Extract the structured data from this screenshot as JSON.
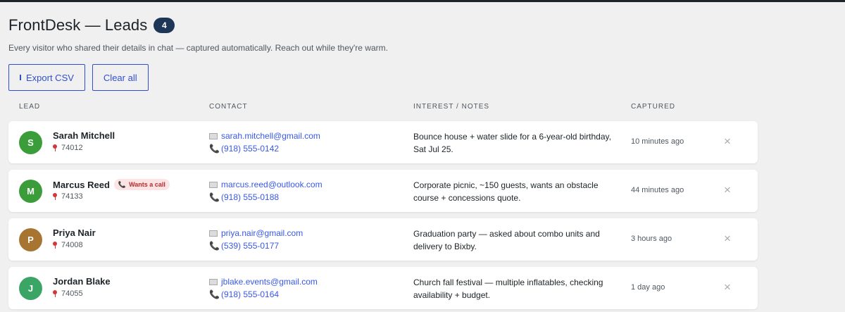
{
  "header": {
    "title": "FrontDesk — Leads",
    "count": "4",
    "subtitle": "Every visitor who shared their details in chat — captured automatically. Reach out while they're warm."
  },
  "actions": {
    "export_label": "Export CSV",
    "clear_label": "Clear all"
  },
  "columns": {
    "lead": "LEAD",
    "contact": "CONTACT",
    "interest": "INTEREST / NOTES",
    "captured": "CAPTURED"
  },
  "leads": [
    {
      "initial": "S",
      "avatar_color": "#3a9d3a",
      "name": "Sarah Mitchell",
      "zip": "74012",
      "badge": "",
      "email": "sarah.mitchell@gmail.com",
      "phone": "(918) 555-0142",
      "notes": "Bounce house + water slide for a 6-year-old birthday, Sat Jul 25.",
      "captured": "10 minutes ago"
    },
    {
      "initial": "M",
      "avatar_color": "#3a9d3a",
      "name": "Marcus Reed",
      "zip": "74133",
      "badge": "Wants a call",
      "email": "marcus.reed@outlook.com",
      "phone": "(918) 555-0188",
      "notes": "Corporate picnic, ~150 guests, wants an obstacle course + concessions quote.",
      "captured": "44 minutes ago"
    },
    {
      "initial": "P",
      "avatar_color": "#a87432",
      "name": "Priya Nair",
      "zip": "74008",
      "badge": "",
      "email": "priya.nair@gmail.com",
      "phone": "(539) 555-0177",
      "notes": "Graduation party — asked about combo units and delivery to Bixby.",
      "captured": "3 hours ago"
    },
    {
      "initial": "J",
      "avatar_color": "#3aa564",
      "name": "Jordan Blake",
      "zip": "74055",
      "badge": "",
      "email": "jblake.events@gmail.com",
      "phone": "(918) 555-0164",
      "notes": "Church fall festival — multiple inflatables, checking availability + budget.",
      "captured": "1 day ago"
    }
  ],
  "icons": {
    "remove": "×",
    "phone": "📞"
  },
  "colors": {
    "accent": "#2f4fd0",
    "link": "#3858e9",
    "badge_bg": "#1d3557",
    "call_badge_bg": "#fde4e4",
    "call_badge_fg": "#b32d2e"
  }
}
